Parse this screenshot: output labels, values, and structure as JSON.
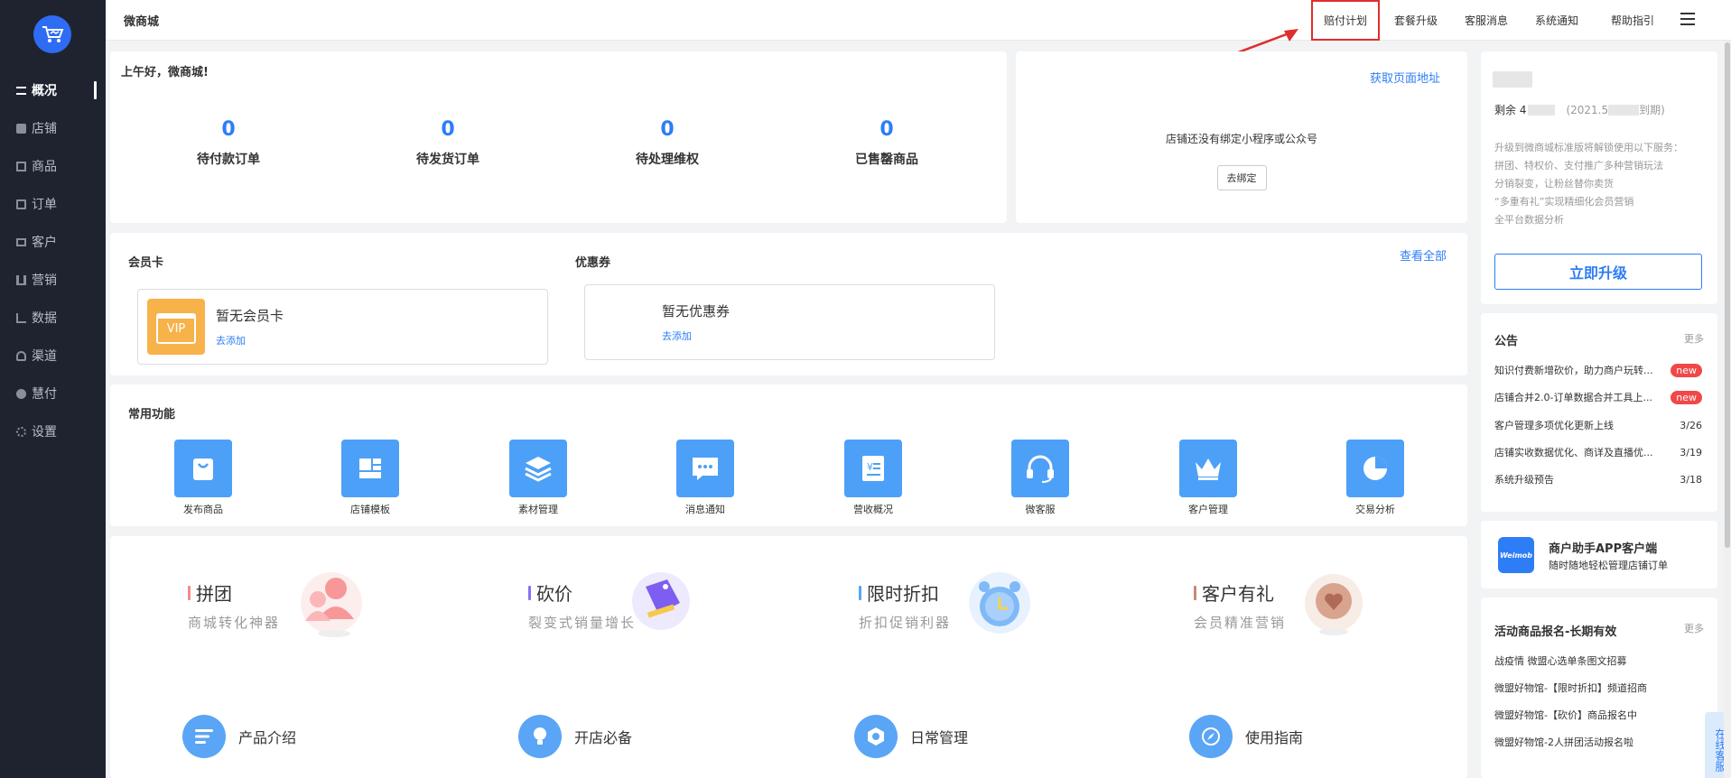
{
  "app": {
    "shop_name": "微商城"
  },
  "sidebar": {
    "items": [
      {
        "label": "概况"
      },
      {
        "label": "店铺"
      },
      {
        "label": "商品"
      },
      {
        "label": "订单"
      },
      {
        "label": "客户"
      },
      {
        "label": "营销"
      },
      {
        "label": "数据"
      },
      {
        "label": "渠道"
      },
      {
        "label": "慧付"
      },
      {
        "label": "设置"
      }
    ]
  },
  "topnav": {
    "items": [
      "赔付计划",
      "套餐升级",
      "客服消息",
      "系统通知",
      "帮助指引"
    ]
  },
  "overview": {
    "greeting": "上午好，微商城!",
    "stats": [
      {
        "value": "0",
        "label": "待付款订单"
      },
      {
        "value": "0",
        "label": "待发货订单"
      },
      {
        "value": "0",
        "label": "待处理维权"
      },
      {
        "value": "0",
        "label": "已售罄商品"
      }
    ]
  },
  "binding": {
    "link": "获取页面地址",
    "message": "店铺还没有绑定小程序或公众号",
    "button": "去绑定"
  },
  "account": {
    "remain_prefix": "剩余 4",
    "remain_suffix": "(2021.5",
    "remain_tail": "到期)",
    "desc_lines": [
      "升级到微商城标准版将解锁使用以下服务：",
      "拼团、特权价、支付推广多种营销玩法",
      "分销裂变，让粉丝替你卖货",
      "“多重有礼”实现精细化会员营销",
      "全平台数据分析"
    ],
    "upgrade_button": "立即升级"
  },
  "cards": {
    "member_title": "会员卡",
    "coupon_title": "优惠券",
    "view_all": "查看全部",
    "member_empty": "暂无会员卡",
    "member_add": "去添加",
    "vip_text": "VIP",
    "coupon_empty": "暂无优惠券",
    "coupon_add": "去添加"
  },
  "functions": {
    "title": "常用功能",
    "items": [
      "发布商品",
      "店铺模板",
      "素材管理",
      "消息通知",
      "营收概况",
      "微客服",
      "客户管理",
      "交易分析"
    ]
  },
  "promos": [
    {
      "title": "拼团",
      "sub": "商城转化神器",
      "color": "#f58a8a"
    },
    {
      "title": "砍价",
      "sub": "裂变式销量增长",
      "color": "#8c6ff2"
    },
    {
      "title": "限时折扣",
      "sub": "折扣促销利器",
      "color": "#5aa5f6"
    },
    {
      "title": "客户有礼",
      "sub": "会员精准营销",
      "color": "#c78a74"
    }
  ],
  "guides": [
    "产品介绍",
    "开店必备",
    "日常管理",
    "使用指南"
  ],
  "notice": {
    "title": "公告",
    "more": "更多",
    "items": [
      {
        "text": "知识付费新增砍价，助力商户玩转...",
        "tag": "new"
      },
      {
        "text": "店铺合并2.0-订单数据合并工具上...",
        "tag": "new"
      },
      {
        "text": "客户管理多项优化更新上线",
        "date": "3/26"
      },
      {
        "text": "店铺实收数据优化、商详及直播优...",
        "date": "3/19"
      },
      {
        "text": "系统升级预告",
        "date": "3/18"
      }
    ]
  },
  "app_promo": {
    "title": "商户助手APP客户端",
    "sub": "随时随地轻松管理店铺订单",
    "logo_text": "Weimob"
  },
  "activity": {
    "title": "活动商品报名-长期有效",
    "more": "更多",
    "items": [
      "战疫情 微盟心选单条图文招募",
      "微盟好物馆-【限时折扣】频道招商",
      "微盟好物馆-【砍价】商品报名中",
      "微盟好物馆-2人拼团活动报名啦"
    ]
  },
  "online_service": "在线客服"
}
